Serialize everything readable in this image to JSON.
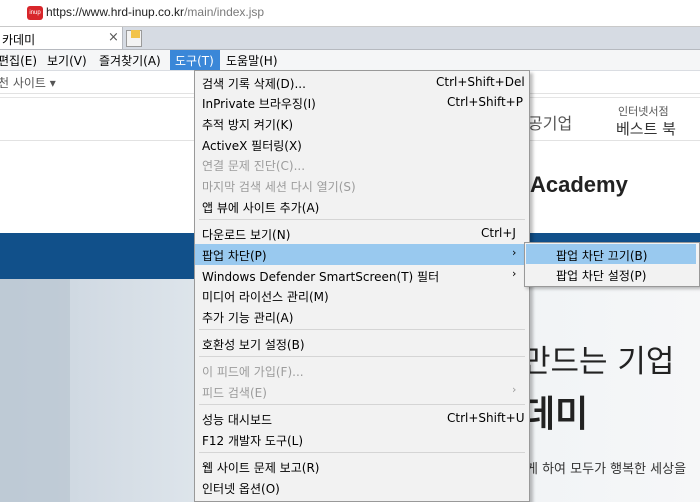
{
  "browser": {
    "url_main": "https://www.hrd-inup.co.kr",
    "url_path": "/main/index.jsp",
    "favicon_text": "inup",
    "tab_title": "카데미",
    "tab_close": "×"
  },
  "menubar": {
    "items": [
      "편집(E)",
      "보기(V)",
      "즐겨찾기(A)",
      "도구(T)",
      "도움말(H)"
    ]
  },
  "favbar": {
    "label": "천 사이트 ▾"
  },
  "page": {
    "nav_item": "공기업",
    "nav_small": "인터넷서점",
    "nav_big": "베스트 북",
    "logo": "Academy",
    "hero_line1": "만드는 기업",
    "hero_line2": "데미",
    "hero_line3": "게 하여 모두가 행복한 세상을"
  },
  "tools_menu": {
    "items": [
      {
        "label": "검색 기록 삭제(D)...",
        "shortcut": "Ctrl+Shift+Del"
      },
      {
        "label": "InPrivate 브라우징(I)",
        "shortcut": "Ctrl+Shift+P"
      },
      {
        "label": "추적 방지 켜기(K)"
      },
      {
        "label": "ActiveX 필터링(X)"
      },
      {
        "label": "연결 문제 진단(C)..."
      },
      {
        "label": "마지막 검색 세션 다시 열기(S)"
      },
      {
        "label": "앱 뷰에 사이트 추가(A)"
      },
      {
        "label": "다운로드 보기(N)",
        "shortcut": "Ctrl+J"
      },
      {
        "label": "팝업 차단(P)",
        "arrow": "›"
      },
      {
        "label": "Windows Defender SmartScreen(T) 필터",
        "arrow": "›"
      },
      {
        "label": "미디어 라이선스 관리(M)"
      },
      {
        "label": "추가 기능 관리(A)"
      },
      {
        "label": "호환성 보기 설정(B)"
      },
      {
        "label": "이 피드에 가입(F)..."
      },
      {
        "label": "피드 검색(E)",
        "arrow": "›"
      },
      {
        "label": "성능 대시보드",
        "shortcut": "Ctrl+Shift+U"
      },
      {
        "label": "F12 개발자 도구(L)"
      },
      {
        "label": "웹 사이트 문제 보고(R)"
      },
      {
        "label": "인터넷 옵션(O)"
      }
    ]
  },
  "popup_submenu": {
    "items": [
      "팝업 차단 끄기(B)",
      "팝업 차단 설정(P)"
    ]
  },
  "colors": {
    "menu_highlight": "#99c9ef",
    "tools_active": "#3a87d8",
    "page_bluebar": "#11508a"
  }
}
